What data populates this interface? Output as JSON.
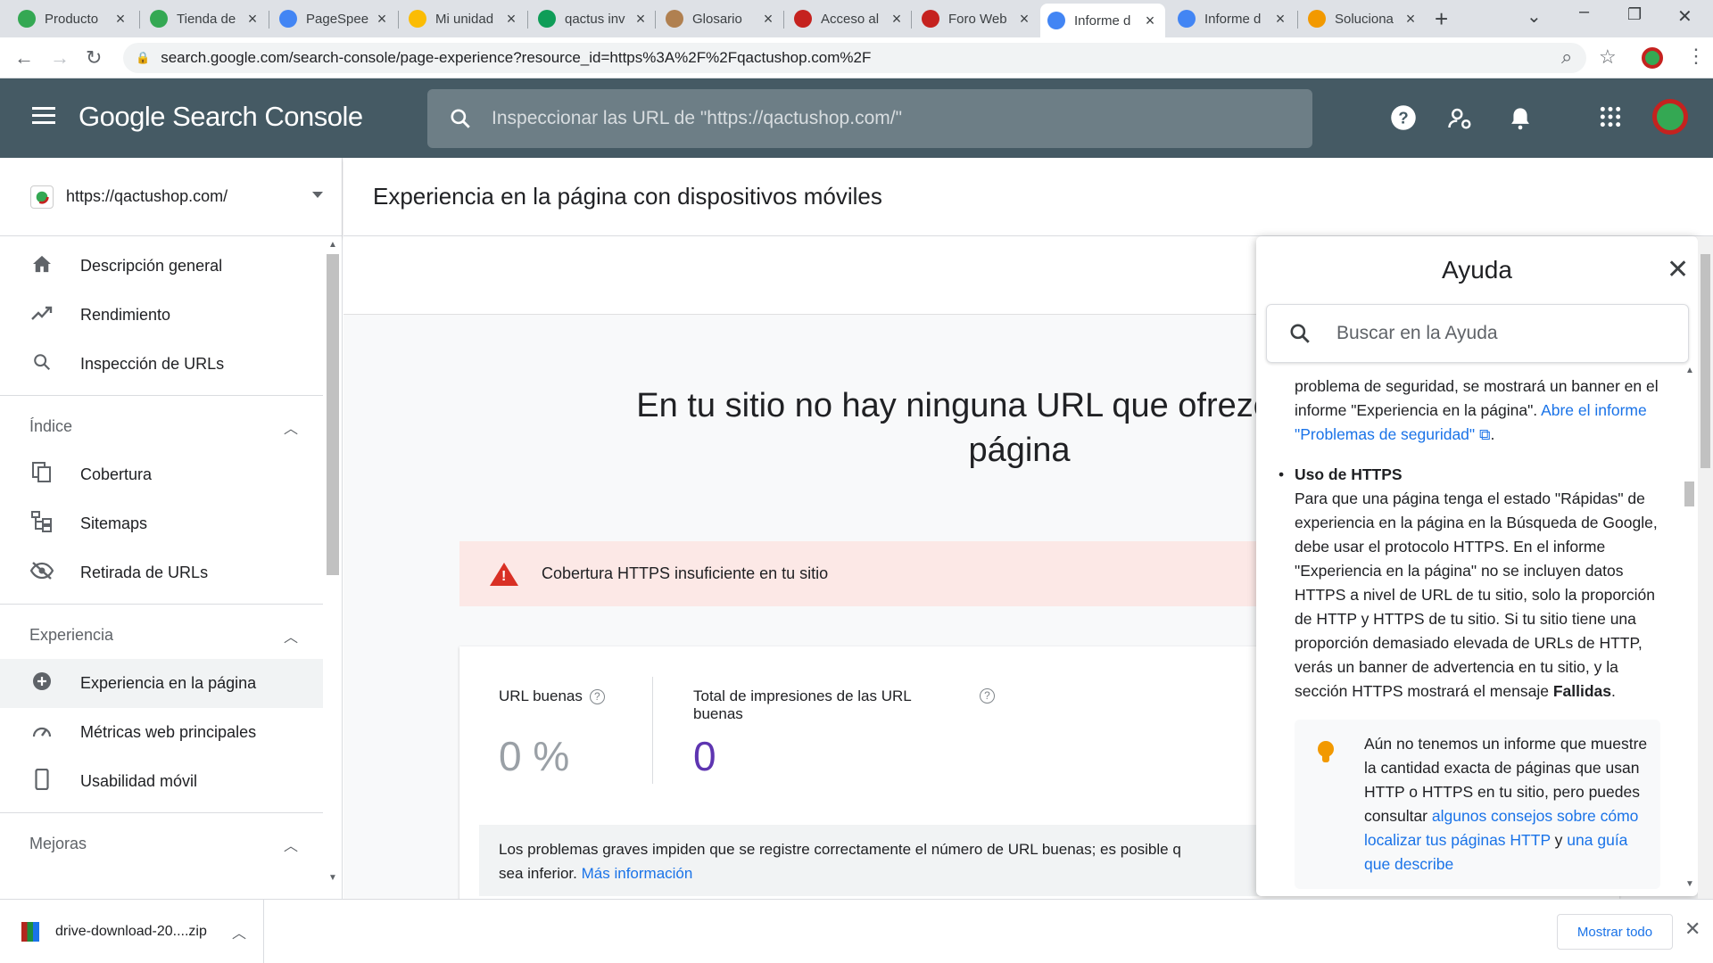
{
  "browser": {
    "tabs": [
      {
        "title": "Producto",
        "color": "#34a853",
        "active": false
      },
      {
        "title": "Tienda de",
        "color": "#34a853",
        "active": false
      },
      {
        "title": "PageSpee",
        "color": "#4285f4",
        "active": false
      },
      {
        "title": "Mi unidad",
        "color": "#fbbc04",
        "active": false
      },
      {
        "title": "qactus inv",
        "color": "#0f9d58",
        "active": false
      },
      {
        "title": "Glosario",
        "color": "#b08050",
        "active": false
      },
      {
        "title": "Acceso al",
        "color": "#c5221f",
        "active": false
      },
      {
        "title": "Foro Web",
        "color": "#c5221f",
        "active": false
      },
      {
        "title": "Informe d",
        "color": "#4285f4",
        "active": true
      },
      {
        "title": "Informe d",
        "color": "#4285f4",
        "active": false
      },
      {
        "title": "Soluciona",
        "color": "#f29900",
        "active": false
      }
    ],
    "url": "search.google.com/search-console/page-experience?resource_id=https%3A%2F%2Fqactushop.com%2F"
  },
  "header": {
    "brand": "Google Search Console",
    "search_placeholder": "Inspeccionar las URL de \"https://qactushop.com/\""
  },
  "sidebar": {
    "property": "https://qactushop.com/",
    "top_items": [
      {
        "label": "Descripción general"
      },
      {
        "label": "Rendimiento"
      },
      {
        "label": "Inspección de URLs"
      }
    ],
    "sections": [
      {
        "title": "Índice",
        "items": [
          {
            "label": "Cobertura"
          },
          {
            "label": "Sitemaps"
          },
          {
            "label": "Retirada de URLs"
          }
        ]
      },
      {
        "title": "Experiencia",
        "items": [
          {
            "label": "Experiencia en la página"
          },
          {
            "label": "Métricas web principales"
          },
          {
            "label": "Usabilidad móvil"
          }
        ]
      },
      {
        "title": "Mejoras",
        "items": []
      }
    ]
  },
  "main": {
    "page_title": "Experiencia en la página con dispositivos móviles",
    "headline_line1": "En tu sitio no hay ninguna URL que ofrezca una bu",
    "headline_line2": "página",
    "banner_text": "Cobertura HTTPS insuficiente en tu sitio",
    "metrics": [
      {
        "label": "URL buenas",
        "value": "0 %",
        "color": "#9aa0a6"
      },
      {
        "label": "Total de impresiones de las URL buenas",
        "value": "0",
        "color": "#5e35b1"
      }
    ],
    "note_text": "Los problemas graves impiden que se registre correctamente el número de URL buenas; es posible q",
    "note_text2": "sea inferior.",
    "note_link": "Más información"
  },
  "help": {
    "title": "Ayuda",
    "search_placeholder": "Buscar en la Ayuda",
    "para1_text": "problema de seguridad, se mostrará un banner en el informe \"Experiencia en la página\".",
    "para1_link": "Abre el informe \"Problemas de seguridad\"",
    "para1_end": ".",
    "bullet_title": "Uso de HTTPS",
    "bullet_text": "Para que una página tenga el estado \"Rápidas\" de experiencia en la página en la Búsqueda de Google, debe usar el protocolo HTTPS. En el informe \"Experiencia en la página\" no se incluyen datos HTTPS a nivel de URL de tu sitio, solo la proporción de HTTP y HTTPS de tu sitio. Si tu sitio tiene una proporción demasiado elevada de URLs de HTTP, verás un banner de advertencia en tu sitio, y la sección HTTPS mostrará el mensaje",
    "bullet_bold": "Fallidas",
    "bullet_end": ".",
    "tip_text": "Aún no tenemos un informe que muestre la cantidad exacta de páginas que usan HTTP o HTTPS en tu sitio, pero puedes consultar",
    "tip_link1": "algunos consejos sobre cómo localizar tus páginas HTTP",
    "tip_and": "y",
    "tip_link2": "una guía que describe"
  },
  "downloads": {
    "file": "drive-download-20....zip",
    "show_all": "Mostrar todo"
  }
}
